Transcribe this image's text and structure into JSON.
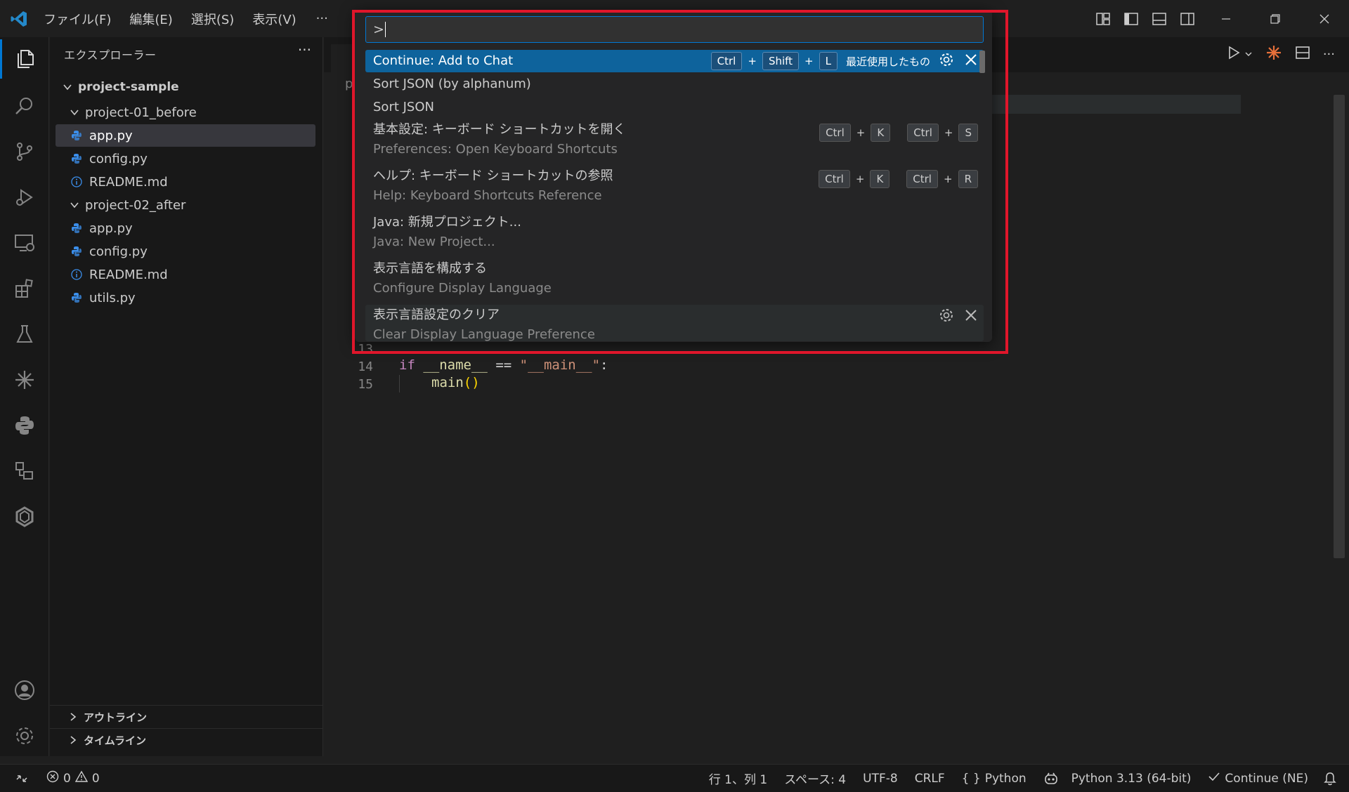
{
  "menu": {
    "file": "ファイル(F)",
    "edit": "編集(E)",
    "selection": "選択(S)",
    "view": "表示(V)",
    "more": "···"
  },
  "explorer": {
    "title": "エクスプローラー",
    "more": "···",
    "root": "project-sample",
    "folders": [
      {
        "name": "project-01_before",
        "files": [
          {
            "name": "app.py",
            "type": "python"
          },
          {
            "name": "config.py",
            "type": "python"
          },
          {
            "name": "README.md",
            "type": "info"
          }
        ]
      },
      {
        "name": "project-02_after",
        "files": [
          {
            "name": "app.py",
            "type": "python"
          },
          {
            "name": "config.py",
            "type": "python"
          },
          {
            "name": "README.md",
            "type": "info"
          },
          {
            "name": "utils.py",
            "type": "python"
          }
        ]
      }
    ],
    "outline": "アウトライン",
    "timeline": "タイムライン"
  },
  "editor": {
    "breadcrumb": "p",
    "lines": [
      {
        "n": "13"
      },
      {
        "n": "14"
      },
      {
        "n": "15"
      }
    ]
  },
  "palette": {
    "input": ">",
    "items": [
      {
        "main": "Continue: Add to Chat",
        "keys": [
          "Ctrl",
          "Shift",
          "L"
        ],
        "recent": "最近使用したもの"
      },
      {
        "main": "Sort JSON (by alphanum)"
      },
      {
        "main": "Sort JSON"
      },
      {
        "main": "基本設定: キーボード ショートカットを開く",
        "sub": "Preferences: Open Keyboard Shortcuts",
        "keys1": [
          "Ctrl",
          "K"
        ],
        "keys2": [
          "Ctrl",
          "S"
        ]
      },
      {
        "main": "ヘルプ: キーボード ショートカットの参照",
        "sub": "Help: Keyboard Shortcuts Reference",
        "keys1": [
          "Ctrl",
          "K"
        ],
        "keys2": [
          "Ctrl",
          "R"
        ]
      },
      {
        "main": "Java: 新規プロジェクト...",
        "sub": "Java: New Project..."
      },
      {
        "main": "表示言語を構成する",
        "sub": "Configure Display Language"
      },
      {
        "main": "表示言語設定のクリア",
        "sub": "Clear Display Language Preference"
      }
    ]
  },
  "status": {
    "errors": "0",
    "warnings": "0",
    "position": "行 1、列 1",
    "spaces": "スペース: 4",
    "encoding": "UTF-8",
    "eol": "CRLF",
    "language": "Python",
    "interpreter": "Python 3.13 (64-bit)",
    "continue": "Continue (NE)"
  },
  "colors": {
    "accent": "#0078d4",
    "highlight": "#e0162b",
    "selection": "#0e639c"
  }
}
